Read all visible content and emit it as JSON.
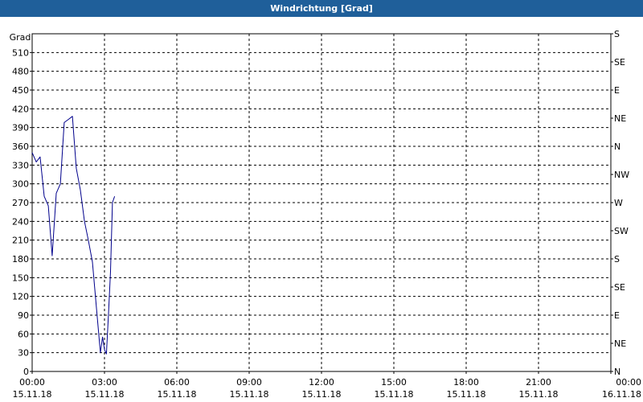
{
  "window": {
    "title": "Windrichtung [Grad]"
  },
  "chart_data": {
    "type": "line",
    "title": "Windrichtung [Grad]",
    "ylabel": "Grad",
    "ylim": [
      0,
      540
    ],
    "yticks": [
      0,
      30,
      60,
      90,
      120,
      150,
      180,
      210,
      240,
      270,
      300,
      330,
      360,
      390,
      420,
      450,
      480,
      510
    ],
    "right_axis_labels": [
      {
        "value": 0,
        "label": "N"
      },
      {
        "value": 45,
        "label": "NE"
      },
      {
        "value": 90,
        "label": "E"
      },
      {
        "value": 135,
        "label": "SE"
      },
      {
        "value": 180,
        "label": "S"
      },
      {
        "value": 225,
        "label": "SW"
      },
      {
        "value": 270,
        "label": "W"
      },
      {
        "value": 315,
        "label": "NW"
      },
      {
        "value": 360,
        "label": "N"
      },
      {
        "value": 405,
        "label": "NE"
      },
      {
        "value": 450,
        "label": "E"
      },
      {
        "value": 495,
        "label": "SE"
      },
      {
        "value": 540,
        "label": "S"
      }
    ],
    "xlim": [
      0,
      24
    ],
    "xticks": [
      {
        "value": 0,
        "time": "00:00",
        "date": "15.11.18"
      },
      {
        "value": 3,
        "time": "03:00",
        "date": "15.11.18"
      },
      {
        "value": 6,
        "time": "06:00",
        "date": "15.11.18"
      },
      {
        "value": 9,
        "time": "09:00",
        "date": "15.11.18"
      },
      {
        "value": 12,
        "time": "12:00",
        "date": "15.11.18"
      },
      {
        "value": 15,
        "time": "15:00",
        "date": "15.11.18"
      },
      {
        "value": 18,
        "time": "18:00",
        "date": "15.11.18"
      },
      {
        "value": 21,
        "time": "21:00",
        "date": "15.11.18"
      },
      {
        "value": 24,
        "time": "00:00",
        "date": "16.11.18"
      }
    ],
    "grid": true,
    "series": [
      {
        "color": "#00008b",
        "x": [
          0.0,
          0.17,
          0.33,
          0.5,
          0.67,
          0.83,
          1.0,
          1.17,
          1.33,
          1.5,
          1.67,
          1.83,
          2.0,
          2.17,
          2.33,
          2.5,
          2.67,
          2.83,
          2.92,
          3.0,
          3.08,
          3.17,
          3.25,
          3.33,
          3.42
        ],
        "y": [
          350,
          335,
          343,
          280,
          265,
          185,
          285,
          300,
          398,
          403,
          408,
          325,
          290,
          240,
          210,
          175,
          100,
          30,
          55,
          35,
          28,
          95,
          160,
          270,
          280
        ]
      }
    ]
  }
}
